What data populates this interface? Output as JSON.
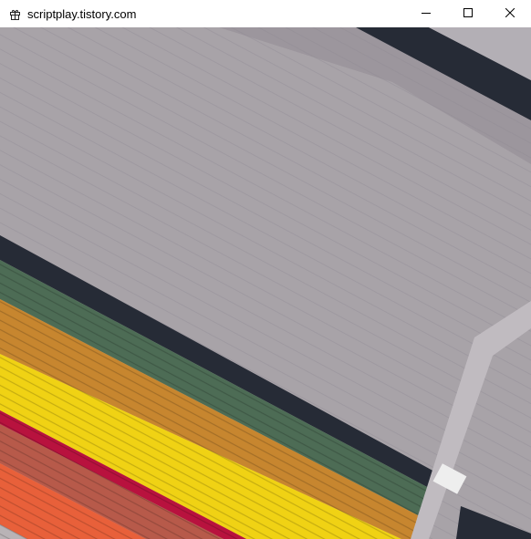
{
  "window": {
    "title": "scriptplay.tistory.com",
    "app_icon": "gift-box-icon",
    "controls": {
      "minimize_icon": "minimize-icon",
      "maximize_icon": "maximize-icon",
      "close_icon": "close-icon"
    }
  },
  "content": {
    "type": "aerial-image",
    "subject": "tulip-fields",
    "colors": {
      "bare_field": "#a8a3a8",
      "water": "#262b36",
      "green_field": "#4d6c55",
      "orange_field": "#c7862f",
      "yellow_field": "#f0d214",
      "magenta_field": "#b8123e",
      "red_field": "#b75a4a",
      "coral_field": "#e8603a"
    }
  }
}
